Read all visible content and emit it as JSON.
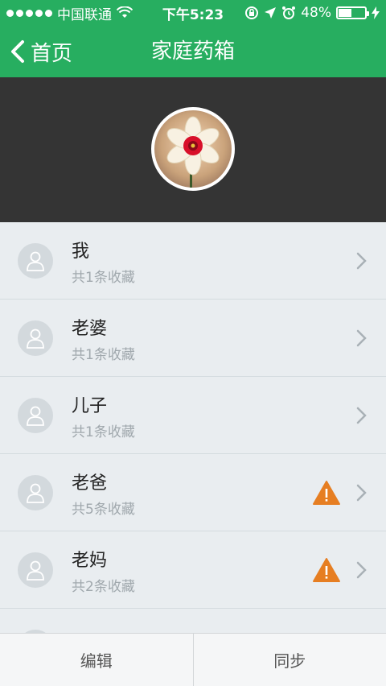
{
  "status_bar": {
    "carrier": "中国联通",
    "time": "下午5:23",
    "battery": "48%",
    "battery_level": 0.48,
    "icons": [
      "signal-dots-icon",
      "wifi-icon",
      "rotation-lock-icon",
      "location-arrow-icon",
      "alarm-icon",
      "battery-icon",
      "charging-bolt-icon"
    ]
  },
  "nav": {
    "back_label": "首页",
    "title": "家庭药箱",
    "back_icon": "chevron-left-icon"
  },
  "colors": {
    "brand_green": "#27ae60",
    "header_dark": "#343434",
    "list_bg": "#e9edf0",
    "warning_orange": "#e67e22"
  },
  "members": [
    {
      "name": "我",
      "count_text": "共1条收藏",
      "warning": false
    },
    {
      "name": "老婆",
      "count_text": "共1条收藏",
      "warning": false
    },
    {
      "name": "儿子",
      "count_text": "共1条收藏",
      "warning": false
    },
    {
      "name": "老爸",
      "count_text": "共5条收藏",
      "warning": true
    },
    {
      "name": "老妈",
      "count_text": "共2条收藏",
      "warning": true
    }
  ],
  "bottom_bar": {
    "edit_label": "编辑",
    "sync_label": "同步"
  }
}
